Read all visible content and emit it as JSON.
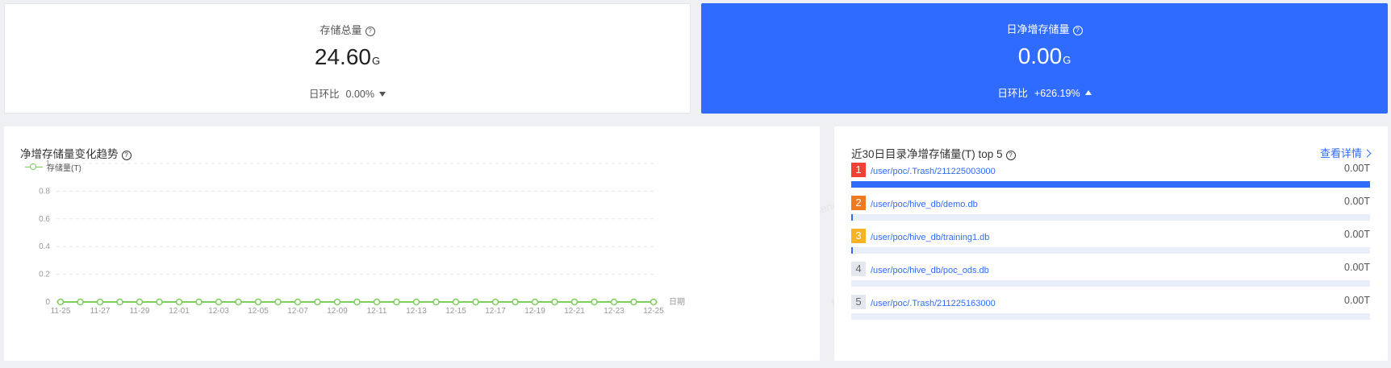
{
  "total_storage": {
    "title": "存储总量",
    "value": "24.60",
    "unit": "G",
    "compare_label": "日环比",
    "compare_value": "0.00%"
  },
  "daily_growth": {
    "title": "日净增存储量",
    "value": "0.00",
    "unit": "G",
    "compare_label": "日环比",
    "compare_value": "+626.19%"
  },
  "trend": {
    "title": "净增存储量变化趋势",
    "legend": "存储量(T)"
  },
  "chart_data": {
    "type": "line",
    "title": "净增存储量变化趋势",
    "xlabel": "日期",
    "ylabel": "",
    "ylim": [
      0,
      1
    ],
    "yticks": [
      "0",
      "0.2",
      "0.4",
      "0.6",
      "0.8",
      "1"
    ],
    "x": [
      "11-25",
      "11-26",
      "11-27",
      "11-28",
      "11-29",
      "11-30",
      "12-01",
      "12-02",
      "12-03",
      "12-04",
      "12-05",
      "12-06",
      "12-07",
      "12-08",
      "12-09",
      "12-10",
      "12-11",
      "12-12",
      "12-13",
      "12-14",
      "12-15",
      "12-16",
      "12-17",
      "12-18",
      "12-19",
      "12-20",
      "12-21",
      "12-22",
      "12-23",
      "12-24",
      "12-25"
    ],
    "xtick_labels": [
      "11-25",
      "11-27",
      "11-29",
      "12-01",
      "12-03",
      "12-05",
      "12-07",
      "12-09",
      "12-11",
      "12-13",
      "12-15",
      "12-17",
      "12-19",
      "12-21",
      "12-23",
      "12-25"
    ],
    "series": [
      {
        "name": "存储量(T)",
        "values": [
          0,
          0,
          0,
          0,
          0,
          0,
          0,
          0,
          0,
          0,
          0,
          0,
          0,
          0,
          0,
          0,
          0,
          0,
          0,
          0,
          0,
          0,
          0,
          0,
          0,
          0,
          0,
          0,
          0,
          0,
          0
        ]
      }
    ],
    "grid": true,
    "legend": "top-left",
    "color": "#7ccf5a"
  },
  "top5": {
    "title": "近30日目录净增存储量(T) top 5",
    "link": "查看详情",
    "items": [
      {
        "rank": "1",
        "path": "/user/poc/.Trash/211225003000",
        "amount": "0.00T",
        "fill": 1.0
      },
      {
        "rank": "2",
        "path": "/user/poc/hive_db/demo.db",
        "amount": "0.00T",
        "fill": 0.002
      },
      {
        "rank": "3",
        "path": "/user/poc/hive_db/training1.db",
        "amount": "0.00T",
        "fill": 0.002
      },
      {
        "rank": "4",
        "path": "/user/poc/hive_db/poc_ods.db",
        "amount": "0.00T",
        "fill": 0
      },
      {
        "rank": "5",
        "path": "/user/poc/.Trash/211225163000",
        "amount": "0.00T",
        "fill": 0
      }
    ]
  },
  "watermark": "fuzheng03",
  "colors": {
    "primary": "#2f6bff",
    "line": "#7ccf5a"
  }
}
